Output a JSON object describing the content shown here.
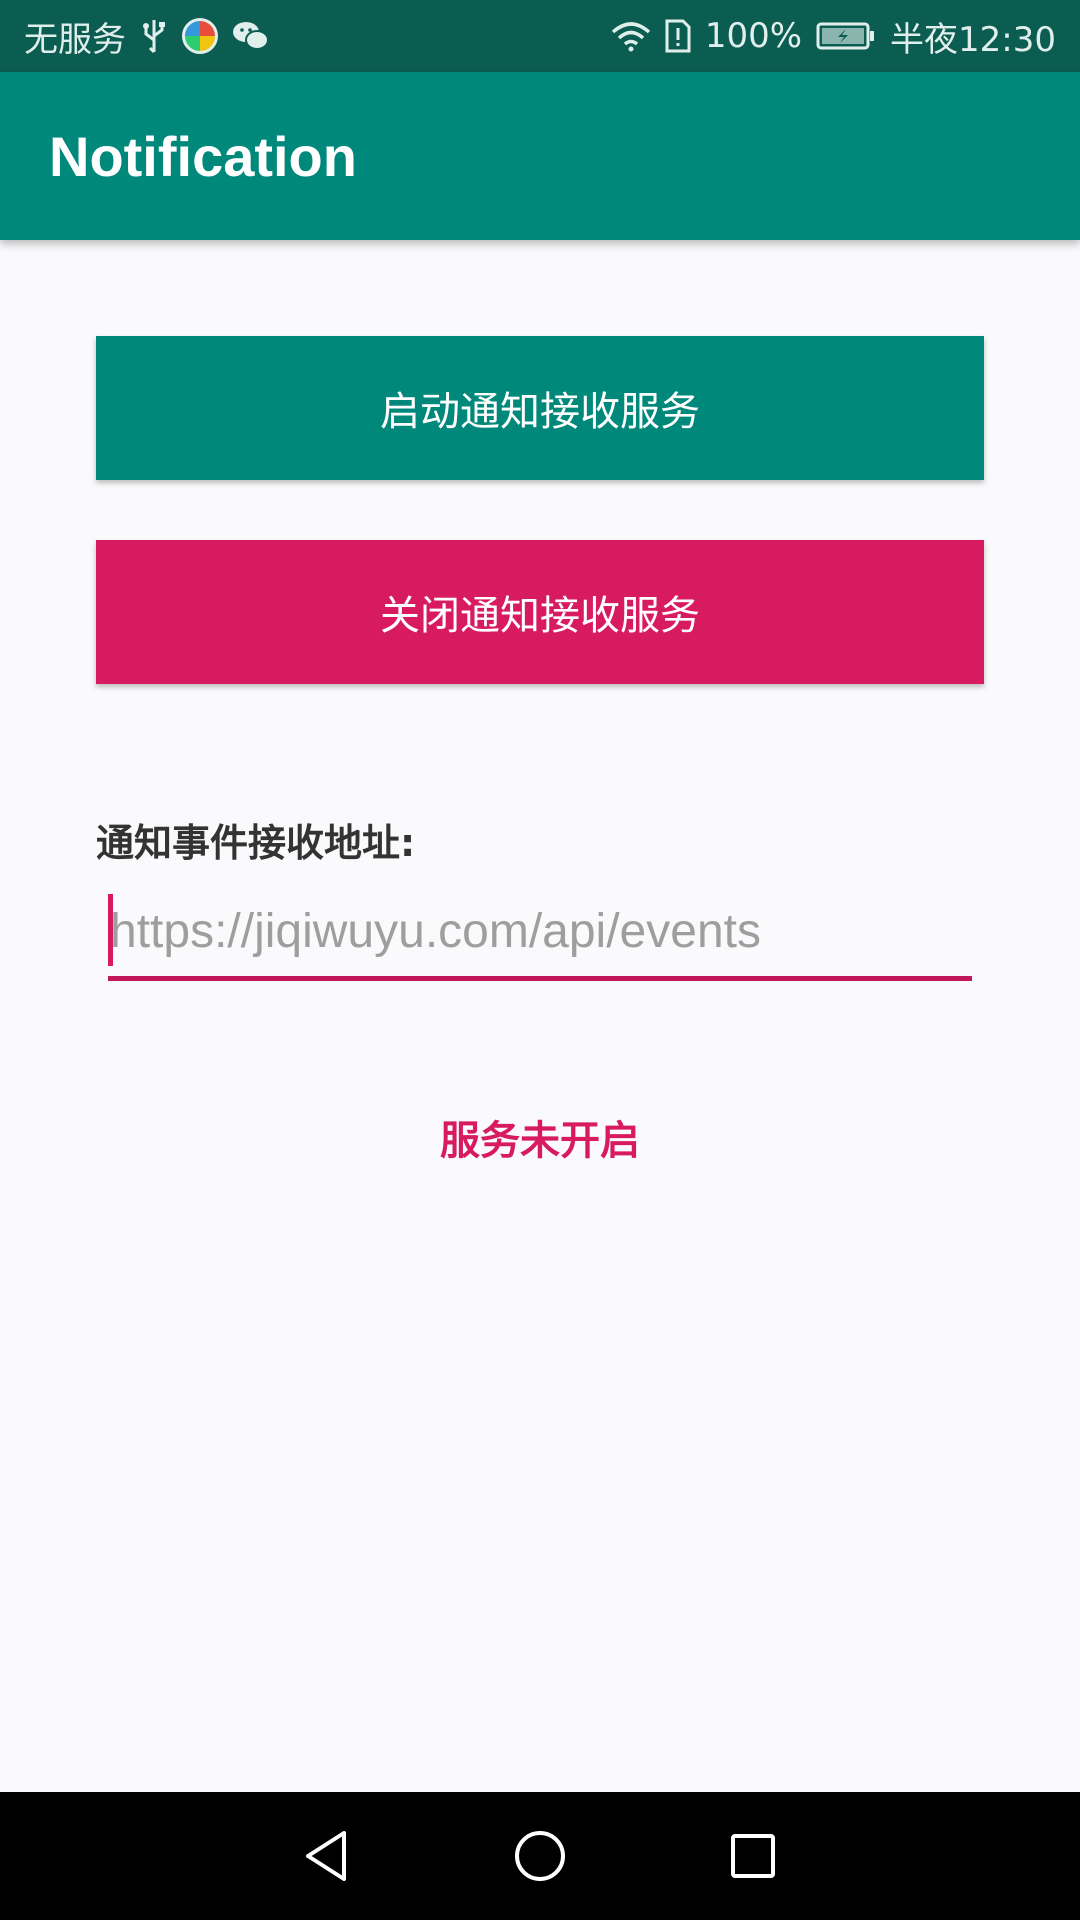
{
  "status_bar": {
    "carrier": "无服务",
    "battery_percent": "100%",
    "time": "半夜12:30",
    "icons": [
      "usb-icon",
      "browser-icon",
      "wechat-icon",
      "wifi-icon",
      "sim-alert-icon",
      "battery-charging-icon"
    ]
  },
  "app_bar": {
    "title": "Notification"
  },
  "main": {
    "start_button_label": "启动通知接收服务",
    "stop_button_label": "关闭通知接收服务",
    "address_label": "通知事件接收地址:",
    "address_input": {
      "value": "",
      "placeholder": "https://jiqiwuyu.com/api/events"
    },
    "service_status": "服务未开启"
  },
  "colors": {
    "primary": "#00897b",
    "primary_dark": "#0b5c51",
    "accent": "#d81b60"
  },
  "nav_bar": {
    "icons": [
      "back-icon",
      "home-icon",
      "recents-icon"
    ]
  }
}
